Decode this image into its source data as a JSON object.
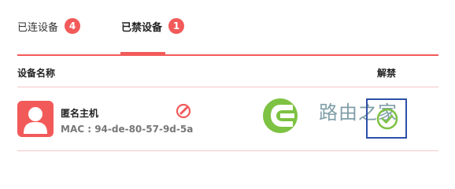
{
  "tabs": [
    {
      "label": "已连设备",
      "count": "4",
      "active": false
    },
    {
      "label": "已禁设备",
      "count": "1",
      "active": true
    }
  ],
  "table": {
    "columns": {
      "name": "设备名称",
      "action": "解禁"
    },
    "rows": [
      {
        "name": "匿名主机",
        "mac": "MAC : 94-de-80-57-9d-5a",
        "avatar_icon": "user-icon",
        "edit_icon": "pencil-icon",
        "action_icon": "unban-check-icon"
      }
    ]
  },
  "watermark": {
    "text": "路由之家"
  },
  "colors": {
    "accent": "#f25a5a",
    "focus_outline": "#2d4fa8",
    "watermark_green": "#7dc242"
  }
}
